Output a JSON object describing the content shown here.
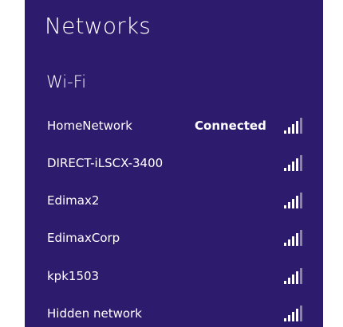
{
  "panel": {
    "title": "Networks",
    "section_title": "Wi-Fi"
  },
  "networks": [
    {
      "name": "HomeNetwork",
      "status": "Connected",
      "signal_icon": "wifi-signal-icon"
    },
    {
      "name": "DIRECT-iLSCX-3400",
      "status": "",
      "signal_icon": "wifi-signal-icon"
    },
    {
      "name": "Edimax2",
      "status": "",
      "signal_icon": "wifi-signal-icon"
    },
    {
      "name": "EdimaxCorp",
      "status": "",
      "signal_icon": "wifi-signal-icon"
    },
    {
      "name": "kpk1503",
      "status": "",
      "signal_icon": "wifi-signal-icon"
    },
    {
      "name": "Hidden network",
      "status": "",
      "signal_icon": "wifi-signal-icon"
    }
  ],
  "colors": {
    "panel_background": "#2d1b6e",
    "text": "#ffffff",
    "outside_background": "#ffffff"
  }
}
